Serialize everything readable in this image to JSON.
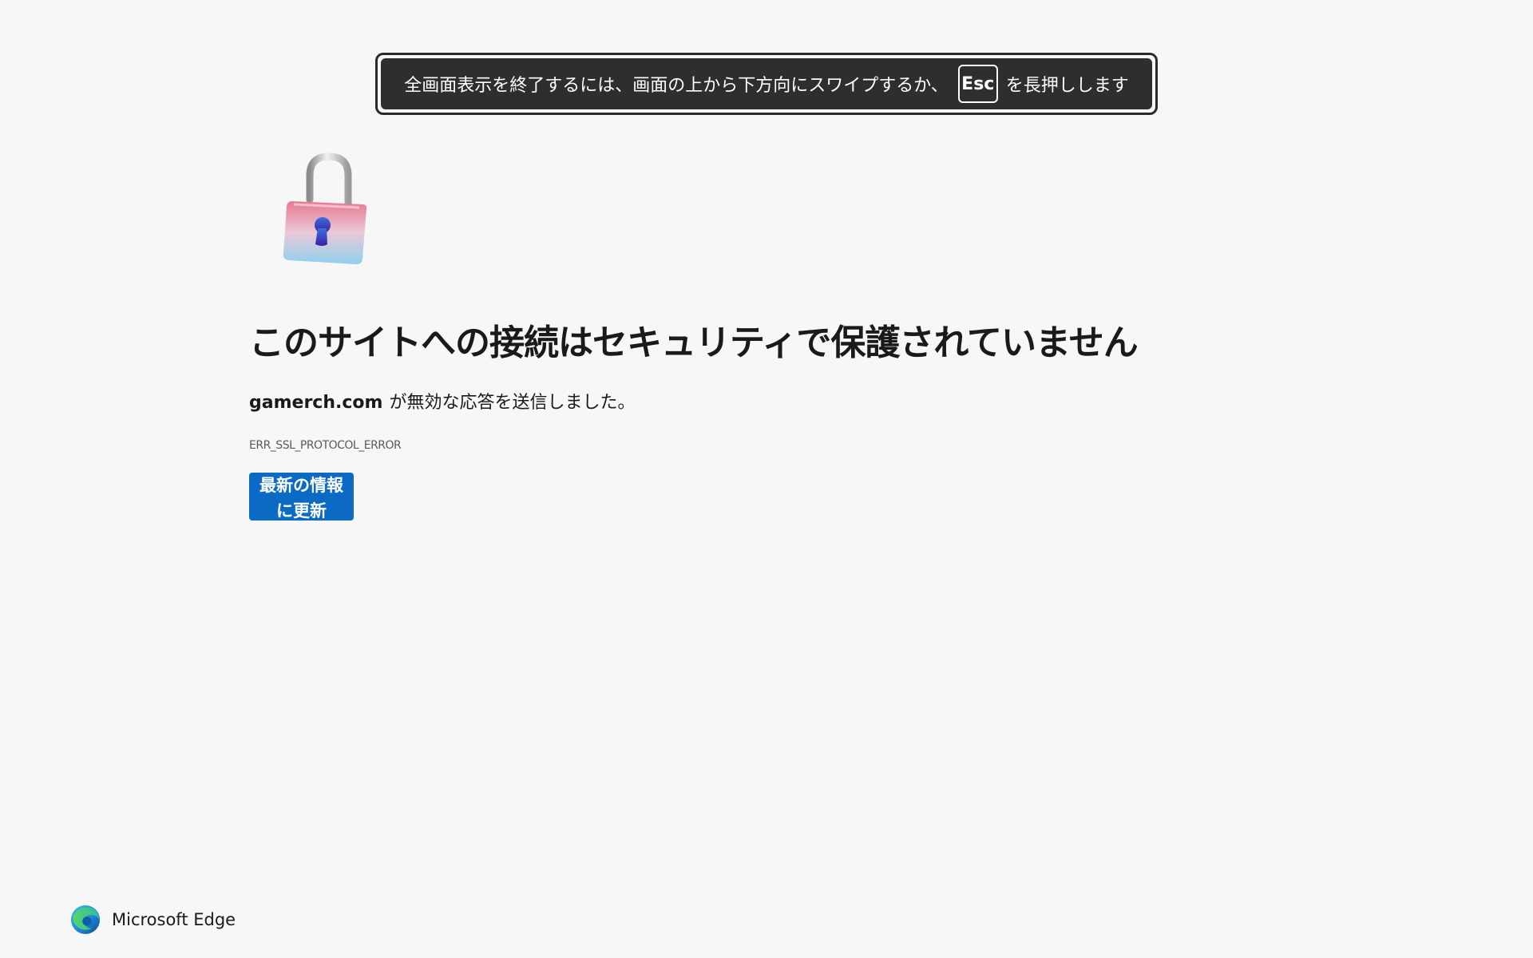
{
  "fullscreen_notice": {
    "text_before": "全画面表示を終了するには、画面の上から下方向にスワイプするか、",
    "key": "Esc",
    "text_after": "を長押しします"
  },
  "error": {
    "icon": "unlocked-padlock-icon",
    "title": "このサイトへの接続はセキュリティで保護されていません",
    "domain": "gamerch.com",
    "message": "が無効な応答を送信しました。",
    "code": "ERR_SSL_PROTOCOL_ERROR",
    "refresh_button_label": "最新の情報に更新"
  },
  "branding": {
    "logo_icon": "edge-logo-icon",
    "name": "Microsoft Edge"
  },
  "colors": {
    "background": "#f7f7f7",
    "toast": "#2e2e2e",
    "button": "#0b6ac4"
  }
}
